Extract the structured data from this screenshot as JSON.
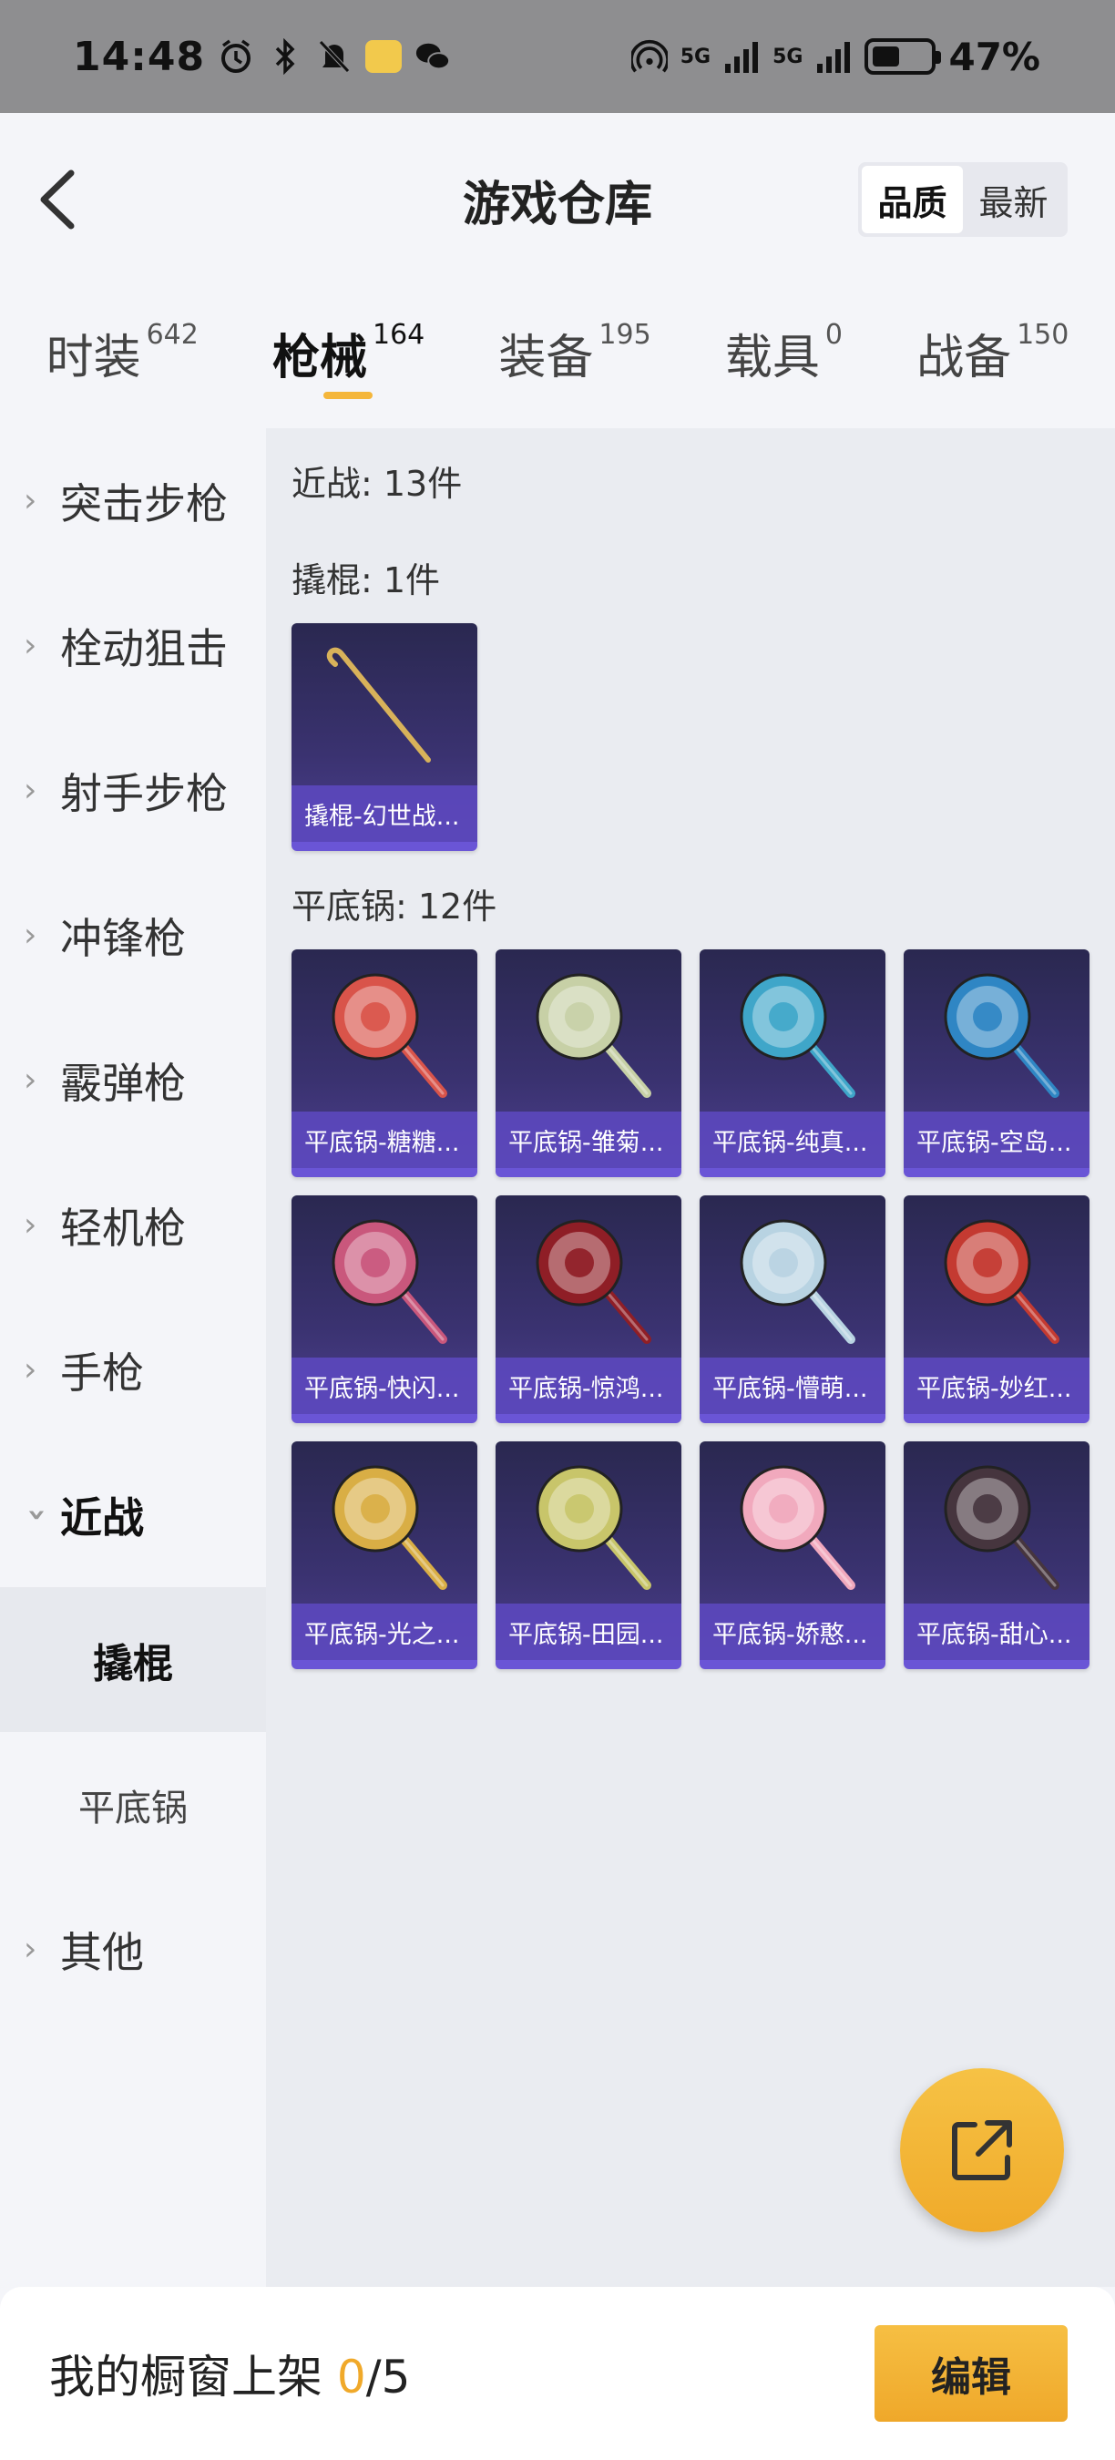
{
  "status_bar": {
    "time": "14:48",
    "battery_percent": "47%",
    "battery_level": 0.47,
    "net_label_1": "5G",
    "net_label_2": "5G",
    "icons": [
      "alarm-icon",
      "bluetooth-icon",
      "mute-icon",
      "app-icon",
      "wechat-icon",
      "hotspot-icon",
      "signal-icon",
      "battery-icon"
    ]
  },
  "header": {
    "title": "游戏仓库",
    "sort_options": [
      "品质",
      "最新"
    ],
    "sort_active": "品质"
  },
  "categories": [
    {
      "label": "时装",
      "count": "642"
    },
    {
      "label": "枪械",
      "count": "164",
      "active": true
    },
    {
      "label": "装备",
      "count": "195"
    },
    {
      "label": "载具",
      "count": "0"
    },
    {
      "label": "战备",
      "count": "150"
    }
  ],
  "sidebar": {
    "items": [
      "突击步枪",
      "栓动狙击",
      "射手步枪",
      "冲锋枪",
      "霰弹枪",
      "轻机枪",
      "手枪"
    ],
    "open_item": "近战",
    "sub_items": [
      "撬棍",
      "平底锅"
    ],
    "sub_active": "撬棍",
    "last_item": "其他"
  },
  "content": {
    "melee_total": "近战: 13件",
    "crowbar_title": "撬棍: 1件",
    "crowbar_items": [
      "撬棍-幻世战..."
    ],
    "pan_title": "平底锅: 12件",
    "pan_items": [
      "平底锅-糖糖...",
      "平底锅-雏菊...",
      "平底锅-纯真...",
      "平底锅-空岛...",
      "平底锅-快闪...",
      "平底锅-惊鸿...",
      "平底锅-懵萌...",
      "平底锅-妙红...",
      "平底锅-光之...",
      "平底锅-田园...",
      "平底锅-娇憨...",
      "平底锅-甜心..."
    ],
    "pan_colors": [
      "#d9544a",
      "#c7d0a6",
      "#3fa6c9",
      "#2f86c4",
      "#c9577c",
      "#8f1e26",
      "#b8d3e2",
      "#c43a31",
      "#d9ae45",
      "#c8c56a",
      "#f1a9bd",
      "#46353e"
    ]
  },
  "bottom_bar": {
    "prefix": "我的橱窗上架 ",
    "current": "0",
    "total": "/5",
    "edit_label": "编辑"
  },
  "colors": {
    "accent": "#f4b63b",
    "card_bg": "#3a3270",
    "card_label": "#5c48be"
  }
}
